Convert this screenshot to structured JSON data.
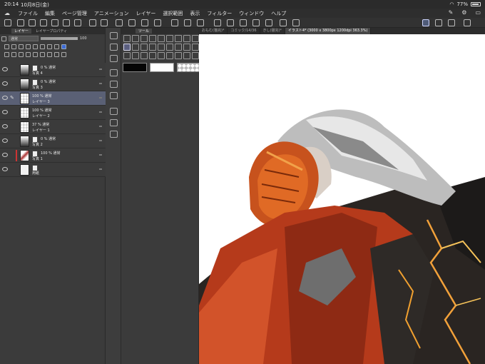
{
  "status": {
    "time": "20:14",
    "date": "10月8日(金)",
    "battery": "77%"
  },
  "menu": [
    "ファイル",
    "編集",
    "ページ管理",
    "アニメーション",
    "レイヤー",
    "選択範囲",
    "表示",
    "フィルター",
    "ウィンドウ",
    "ヘルプ"
  ],
  "layer_panel": {
    "tabs": [
      "レイヤー",
      "レイヤープロパティ"
    ],
    "blend_mode": "通常",
    "opacity": "100"
  },
  "layers": [
    {
      "line1": "0 % 通常",
      "line2": "写真 4"
    },
    {
      "line1": "0 % 通常",
      "line2": "写真 3"
    },
    {
      "line1": "100 % 通常",
      "line2": "レイヤー 3"
    },
    {
      "line1": "100 % 通常",
      "line2": "レイヤー 2"
    },
    {
      "line1": "37 % 通常",
      "line2": "レイヤー 1"
    },
    {
      "line1": "0 % 通常",
      "line2": "写真 2"
    },
    {
      "line1": "100 % 通常",
      "line2": "写真 1"
    },
    {
      "line1": "",
      "line2": "用紙"
    }
  ],
  "tool_panel": {
    "tabs": [
      "ツール"
    ]
  },
  "doc_tabs": [
    {
      "label": "おもむ(猫完)*"
    },
    {
      "label": "コミック/14/36"
    },
    {
      "label": "きし(猫完)*"
    },
    {
      "label": "イラスト4* (3000 x 3800px 1200dpi 363.3%)"
    }
  ]
}
